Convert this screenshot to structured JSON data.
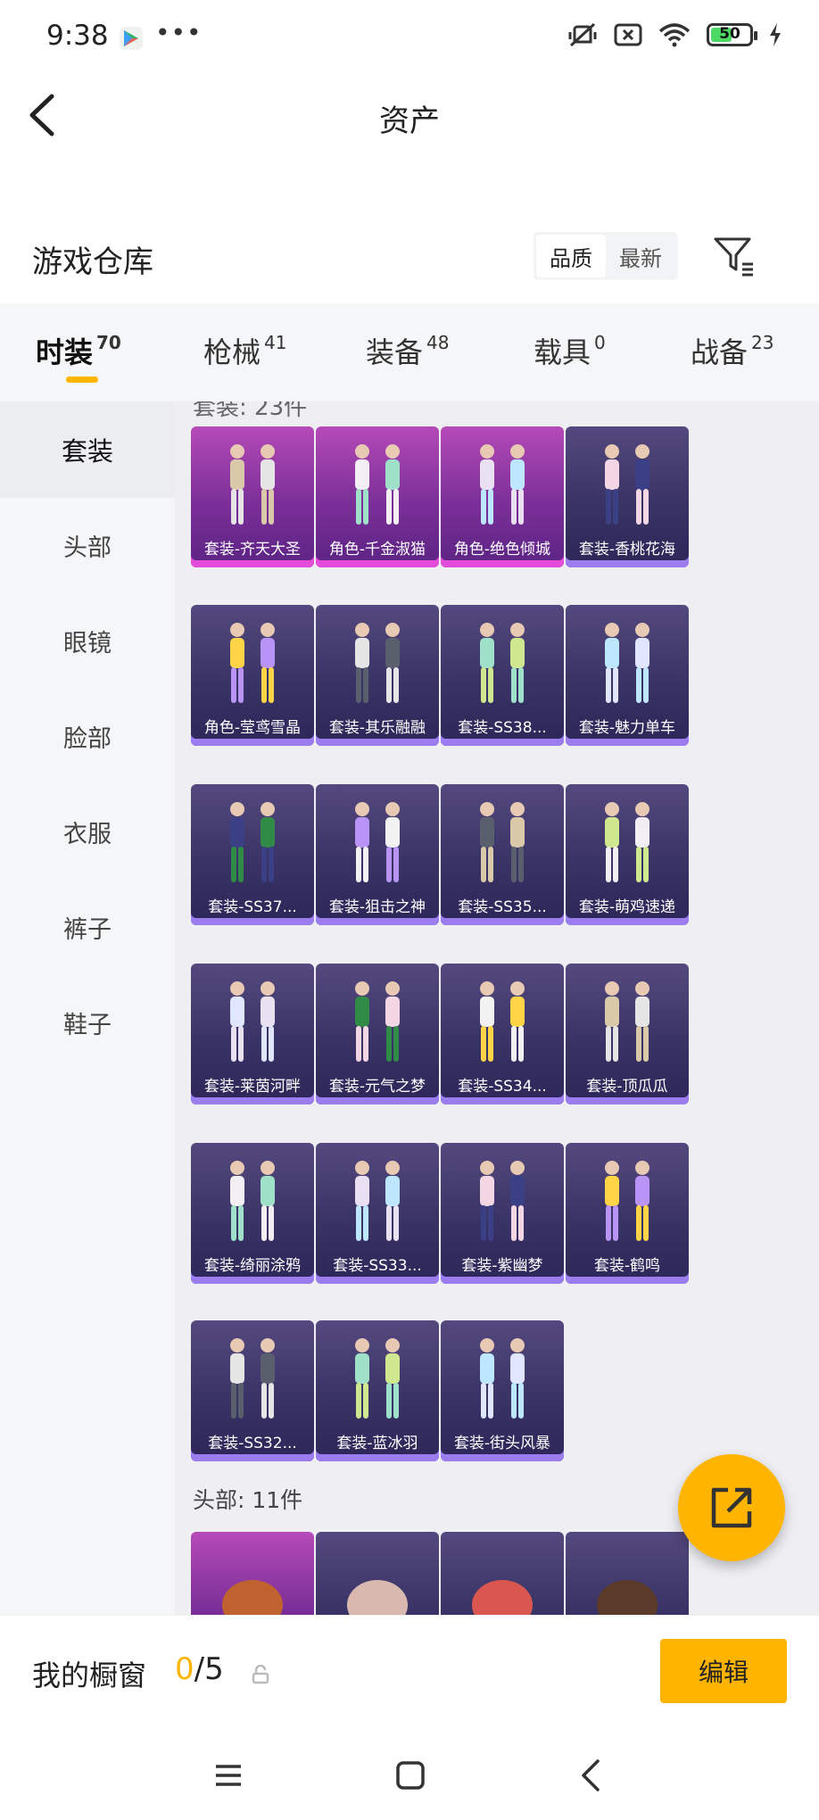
{
  "status_bar": {
    "time": "9:38",
    "more": "•••",
    "battery_level": "50"
  },
  "header": {
    "title": "资产"
  },
  "warehouse": {
    "title": "游戏仓库",
    "sort_options": [
      "品质",
      "最新"
    ],
    "active_sort": "品质"
  },
  "tabs": [
    {
      "label": "时装",
      "count": "70"
    },
    {
      "label": "枪械",
      "count": "41"
    },
    {
      "label": "装备",
      "count": "48"
    },
    {
      "label": "载具",
      "count": "0"
    },
    {
      "label": "战备",
      "count": "23"
    }
  ],
  "sidebar": {
    "items": [
      "套装",
      "头部",
      "眼镜",
      "脸部",
      "衣服",
      "裤子",
      "鞋子"
    ],
    "active": "套装"
  },
  "content": {
    "cut_label": "套装: 23件",
    "suits": [
      {
        "name": "套装-齐天大圣",
        "quality": "purple"
      },
      {
        "name": "角色-千金淑猫",
        "quality": "purple"
      },
      {
        "name": "角色-绝色倾城",
        "quality": "purple"
      },
      {
        "name": "套装-香桃花海",
        "quality": "blue"
      },
      {
        "name": "角色-莹鸢雪晶",
        "quality": "blue"
      },
      {
        "name": "套装-其乐融融",
        "quality": "blue"
      },
      {
        "name": "套装-SS38...",
        "quality": "blue"
      },
      {
        "name": "套装-魅力单车",
        "quality": "blue"
      },
      {
        "name": "套装-SS37...",
        "quality": "blue"
      },
      {
        "name": "套装-狙击之神",
        "quality": "blue"
      },
      {
        "name": "套装-SS35...",
        "quality": "blue"
      },
      {
        "name": "套装-萌鸡速递",
        "quality": "blue"
      },
      {
        "name": "套装-莱茵河畔",
        "quality": "blue"
      },
      {
        "name": "套装-元气之梦",
        "quality": "blue"
      },
      {
        "name": "套装-SS34...",
        "quality": "blue"
      },
      {
        "name": "套装-顶瓜瓜",
        "quality": "blue"
      },
      {
        "name": "套装-绮丽涂鸦",
        "quality": "blue"
      },
      {
        "name": "套装-SS33...",
        "quality": "blue"
      },
      {
        "name": "套装-紫幽梦",
        "quality": "blue"
      },
      {
        "name": "套装-鹤鸣",
        "quality": "blue"
      },
      {
        "name": "套装-SS32...",
        "quality": "blue"
      },
      {
        "name": "套装-蓝冰羽",
        "quality": "blue"
      },
      {
        "name": "套装-街头风暴",
        "quality": "blue"
      }
    ],
    "head_label": "头部: 11件",
    "heads": [
      {
        "quality": "purple"
      },
      {
        "quality": "blue"
      },
      {
        "quality": "blue"
      },
      {
        "quality": "blue"
      }
    ]
  },
  "showcase": {
    "label": "我的橱窗",
    "current": "0",
    "separator": "/5",
    "edit_label": "编辑"
  },
  "colors": {
    "accent": "#ffb400",
    "purple_card": "#7b2f98",
    "blue_card": "#3a3366"
  },
  "icons": {
    "back": "chevron-left-icon",
    "filter": "filter-icon",
    "share": "share-icon",
    "lock": "lock-icon",
    "menu": "menu-icon",
    "home": "home-icon",
    "nav_back": "nav-back-icon"
  }
}
